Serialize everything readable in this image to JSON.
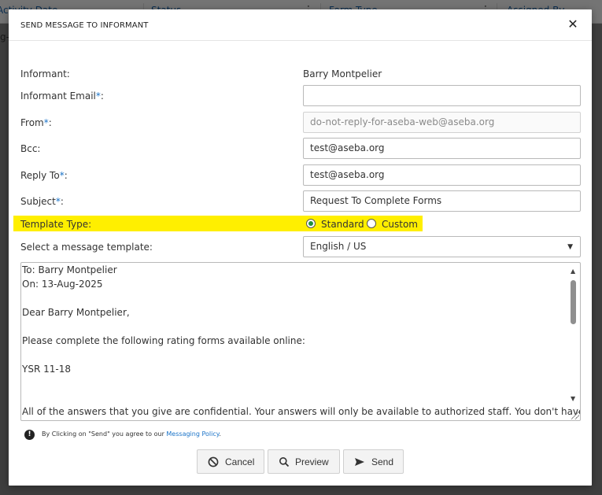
{
  "background": {
    "header_cols": [
      "Activity Date",
      "Status",
      "Form Type",
      "Assigned By"
    ],
    "side_fragment": "g-"
  },
  "dialog": {
    "title": "SEND MESSAGE TO INFORMANT",
    "close_glyph": "✕"
  },
  "form": {
    "informant": {
      "label": "Informant:",
      "value": "Barry Montpelier"
    },
    "informant_email": {
      "label": "Informant Email",
      "required_mark": "*",
      "suffix": ":",
      "value": ""
    },
    "from": {
      "label": "From",
      "required_mark": "*",
      "suffix": ":",
      "value": "do-not-reply-for-aseba-web@aseba.org"
    },
    "bcc": {
      "label": "Bcc:",
      "value": "test@aseba.org"
    },
    "reply_to": {
      "label": "Reply To",
      "required_mark": "*",
      "suffix": ":",
      "value": "test@aseba.org"
    },
    "subject": {
      "label": "Subject",
      "required_mark": "*",
      "suffix": ":",
      "value": "Request To Complete Forms"
    },
    "template_type": {
      "label": "Template Type:",
      "options": [
        {
          "label": "Standard",
          "checked": true
        },
        {
          "label": "Custom",
          "checked": false
        }
      ],
      "highlight_color": "#ffef00"
    },
    "message_template": {
      "label": "Select a message template:",
      "selected": "English / US"
    },
    "message_body": [
      "To: Barry Montpelier",
      "On: 13-Aug-2025",
      "",
      "Dear Barry Montpelier,",
      "",
      "Please complete the following rating forms available online:",
      "",
      "YSR 11-18",
      "",
      "",
      "All of the answers that you give are confidential. Your answers will only be available to authorized staff. You don't have to"
    ]
  },
  "policy": {
    "icon": "info-icon",
    "text_before": "By Clicking on \"Send\" you agree to our ",
    "link_text": "Messaging Policy",
    "text_after": "."
  },
  "buttons": {
    "cancel": {
      "label": "Cancel",
      "icon": "ban-icon"
    },
    "preview": {
      "label": "Preview",
      "icon": "search-icon"
    },
    "send": {
      "label": "Send",
      "icon": "send-icon"
    }
  },
  "colors": {
    "required": "#1a73c8",
    "link": "#1a73c8",
    "radio_checked": "#1f8f3a"
  }
}
